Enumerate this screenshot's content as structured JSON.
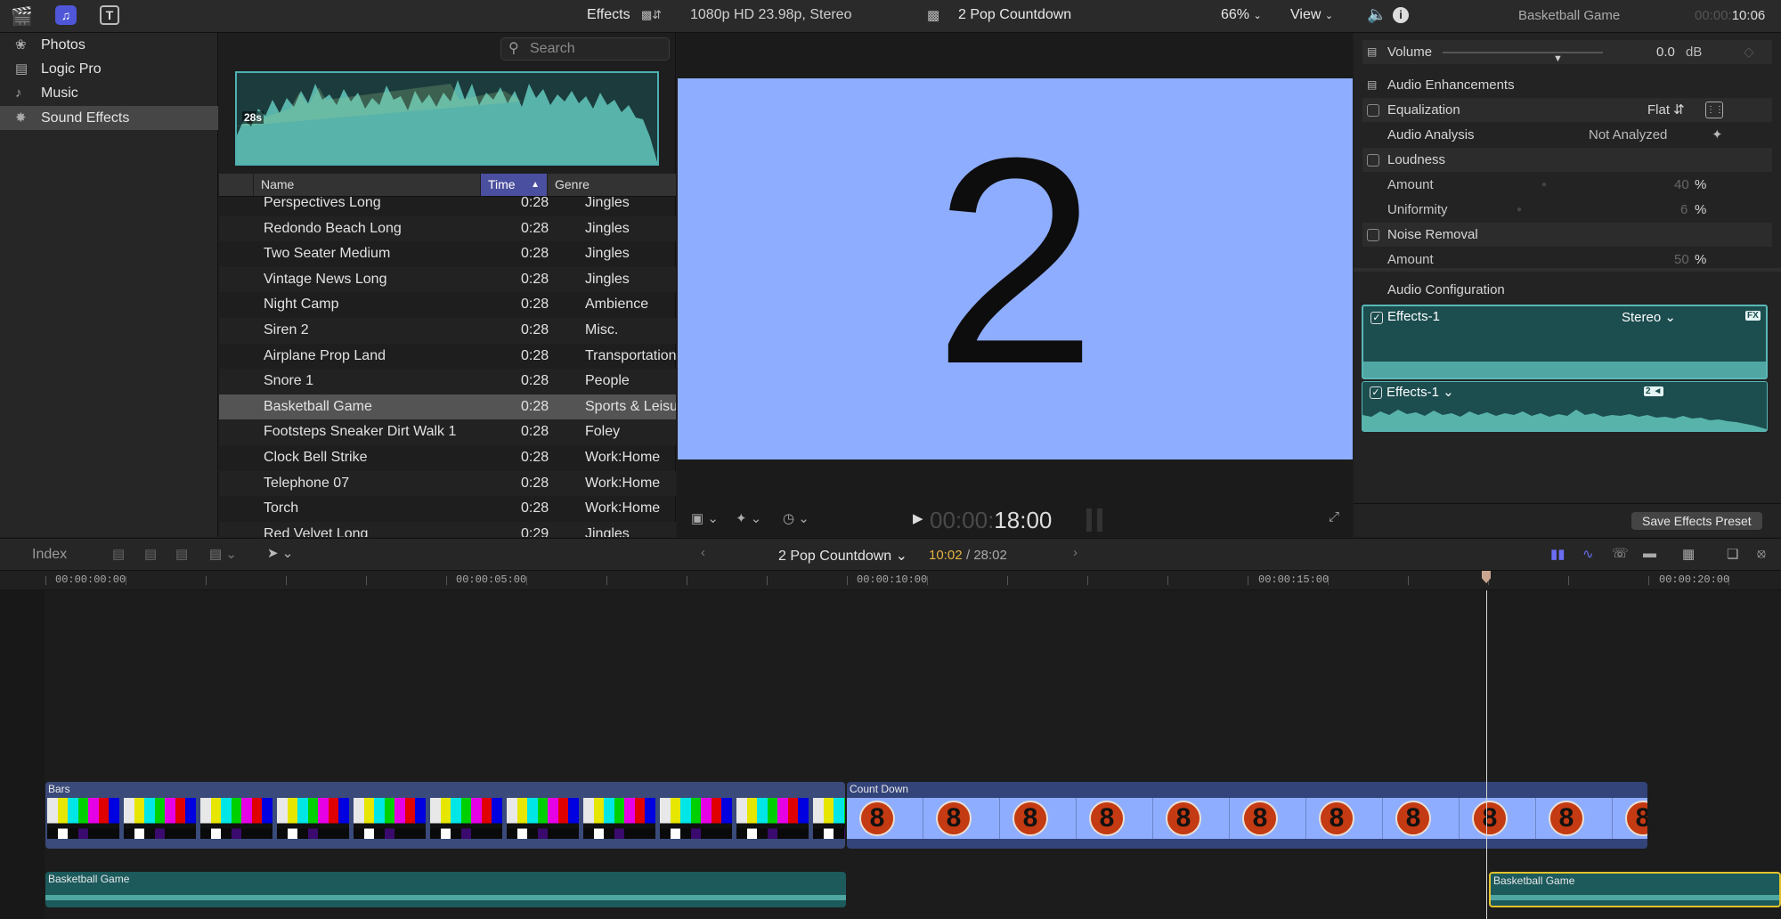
{
  "topbar": {
    "effects_label": "Effects",
    "format": "1080p HD 23.98p, Stereo",
    "project": "2 Pop Countdown",
    "zoom": "66%",
    "view": "View",
    "inspector_title": "Basketball Game",
    "tc_dim": "00:00:",
    "tc_bright": "10:06"
  },
  "sidebar": {
    "items": [
      {
        "label": "Photos",
        "icon": "flower-icon"
      },
      {
        "label": "Logic Pro",
        "icon": "logic-icon"
      },
      {
        "label": "Music",
        "icon": "music-note-icon"
      },
      {
        "label": "Sound Effects",
        "icon": "burst-icon"
      }
    ]
  },
  "browser": {
    "search_placeholder": "Search",
    "filmstrip_duration": "28s",
    "columns": [
      "Name",
      "Time",
      "Genre"
    ],
    "rows": [
      {
        "name": "Perspectives Long",
        "time": "0:28",
        "genre": "Jingles"
      },
      {
        "name": "Redondo Beach Long",
        "time": "0:28",
        "genre": "Jingles"
      },
      {
        "name": "Two Seater Medium",
        "time": "0:28",
        "genre": "Jingles"
      },
      {
        "name": "Vintage News Long",
        "time": "0:28",
        "genre": "Jingles"
      },
      {
        "name": "Night Camp",
        "time": "0:28",
        "genre": "Ambience"
      },
      {
        "name": "Siren 2",
        "time": "0:28",
        "genre": "Misc."
      },
      {
        "name": "Airplane Prop Land",
        "time": "0:28",
        "genre": "Transportation"
      },
      {
        "name": "Snore 1",
        "time": "0:28",
        "genre": "People"
      },
      {
        "name": "Basketball Game",
        "time": "0:28",
        "genre": "Sports & Leisure"
      },
      {
        "name": "Footsteps Sneaker Dirt Walk 1",
        "time": "0:28",
        "genre": "Foley"
      },
      {
        "name": "Clock Bell Strike",
        "time": "0:28",
        "genre": "Work:Home"
      },
      {
        "name": "Telephone 07",
        "time": "0:28",
        "genre": "Work:Home"
      },
      {
        "name": "Torch",
        "time": "0:28",
        "genre": "Work:Home"
      },
      {
        "name": "Red Velvet Long",
        "time": "0:29",
        "genre": "Jingles"
      }
    ],
    "selected_row": 8
  },
  "viewer": {
    "frame_digit": "2",
    "tc_dim": "00:00:",
    "tc_bright": "18:00"
  },
  "inspector": {
    "volume_label": "Volume",
    "volume_value": "0.0",
    "volume_unit": "dB",
    "enhancements": "Audio Enhancements",
    "equalization": "Equalization",
    "eq_value": "Flat",
    "analysis": "Audio Analysis",
    "analysis_value": "Not Analyzed",
    "loudness": "Loudness",
    "amount": "Amount",
    "loud_amount": "40",
    "uniformity": "Uniformity",
    "uniformity_value": "6",
    "percent": "%",
    "noise_removal": "Noise Removal",
    "noise_amount": "50",
    "audio_config": "Audio Configuration",
    "lane1_name": "Effects-1",
    "lane1_mode": "Stereo",
    "lane1_badge": "FX",
    "lane2_name": "Effects-1",
    "lane2_badge": "2",
    "save_preset": "Save Effects Preset"
  },
  "timeline": {
    "index_label": "Index",
    "project": "2 Pop Countdown",
    "position": "10:02",
    "duration": "/ 28:02",
    "ruler": [
      "00:00:00:00",
      "00:00:05:00",
      "00:00:10:00",
      "00:00:15:00",
      "00:00:20:00"
    ],
    "clip_bars": "Bars",
    "clip_countdown": "Count Down",
    "countdown_digit": "8",
    "audio_clip_1": "Basketball Game",
    "audio_clip_2": "Basketball Game"
  },
  "colors": {
    "accent": "#5c5fd6",
    "audio": "#1c5a5c",
    "audio_selected": "#e3c12b",
    "frame_bg": "#8fadff"
  }
}
